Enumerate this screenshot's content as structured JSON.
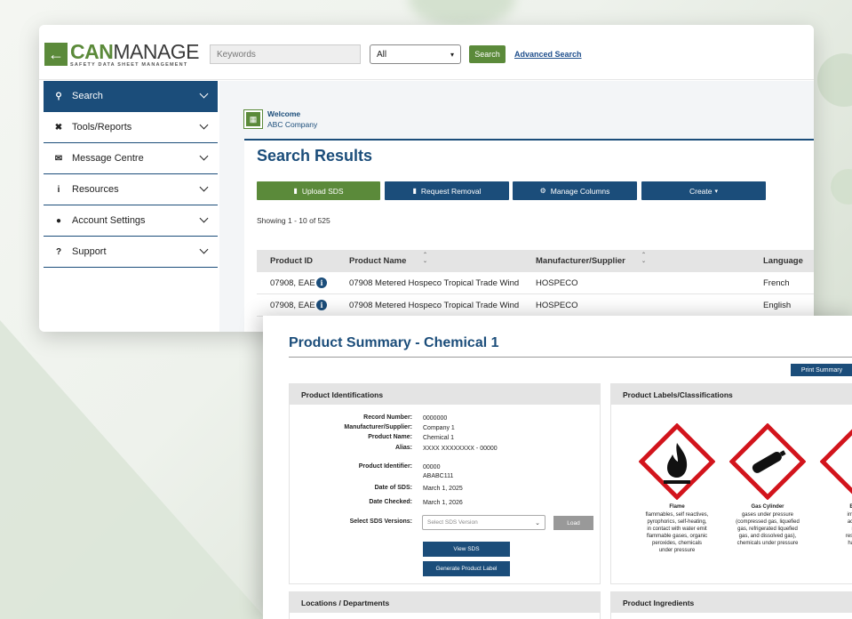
{
  "topbar": {
    "logo_can": "CAN",
    "logo_manage": "MANAGE",
    "logo_tagline": "SAFETY DATA SHEET MANAGEMENT",
    "keywords_placeholder": "Keywords",
    "scope_selected": "All",
    "search_label": "Search",
    "advanced_search_label": "Advanced Search"
  },
  "sidebar": {
    "items": [
      {
        "label": "Search",
        "icon": "search-icon",
        "active": true
      },
      {
        "label": "Tools/Reports",
        "icon": "tools-icon"
      },
      {
        "label": "Message Centre",
        "icon": "message-icon"
      },
      {
        "label": "Resources",
        "icon": "info-icon"
      },
      {
        "label": "Account Settings",
        "icon": "user-icon"
      },
      {
        "label": "Support",
        "icon": "question-icon"
      }
    ]
  },
  "welcome": {
    "greeting": "Welcome",
    "company": "ABC Company"
  },
  "results": {
    "title": "Search Results",
    "actions": {
      "upload": "Upload SDS",
      "request_removal": "Request Removal",
      "manage_columns": "Manage Columns",
      "create": "Create"
    },
    "showing_prefix": "Showing",
    "showing_range": "1 - 10",
    "showing_of": "of 525",
    "columns": [
      "Product ID",
      "Product Name",
      "Manufacturer/Supplier",
      "Language"
    ],
    "rows": [
      {
        "id": "07908, EAE",
        "name": "07908 Metered Hospeco Tropical Trade Wind",
        "manufacturer": "HOSPECO",
        "language": "French"
      },
      {
        "id": "07908, EAE",
        "name": "07908 Metered Hospeco Tropical Trade Wind",
        "manufacturer": "HOSPECO",
        "language": "English"
      }
    ]
  },
  "summary": {
    "title": "Product Summary - Chemical 1",
    "print_label": "Print Summary",
    "identifications": {
      "header": "Product Identifications",
      "record_number_label": "Record Number:",
      "record_number": "0000000",
      "manufacturer_label": "Manufacturer/Supplier:",
      "manufacturer": "Company 1",
      "product_name_label": "Product Name:",
      "product_name": "Chemical 1",
      "alias_label": "Alias:",
      "alias": "XXXX XXXXXXXX - 00000",
      "identifier_label": "Product Identifier:",
      "identifier_1": "00000",
      "identifier_2": "ABABC111",
      "date_sds_label": "Date of SDS:",
      "date_sds": "March 1, 2025",
      "date_checked_label": "Date Checked:",
      "date_checked": "March 1, 2026",
      "select_versions_label": "Select SDS Versions:",
      "select_versions_placeholder": "Select SDS Version",
      "load_label": "Load",
      "view_sds_label": "View SDS",
      "generate_label_label": "Generate Product Label"
    },
    "labels": {
      "header": "Product Labels/Classifications",
      "pictograms": [
        {
          "name": "Flame",
          "icon": "flame-icon",
          "desc": [
            "flammables, self reactives,",
            "pyrophorics, self-heating,",
            "in contact with water emit",
            "flammable gases, organic",
            "peroxides, chemicals",
            "under pressure"
          ]
        },
        {
          "name": "Gas Cylinder",
          "icon": "gas-cylinder-icon",
          "desc": [
            "gases under pressure",
            "(compressed gas, liquefied",
            "gas, refrigerated liquefied",
            "gas, and dissolved gas),",
            "chemicals under pressure"
          ]
        },
        {
          "name": "Exclan",
          "icon": "exclamation-icon",
          "desc": [
            "irritation (",
            "acute tox",
            "narco",
            "respiratory",
            "harmful t"
          ]
        }
      ]
    },
    "locations_header": "Locations / Departments",
    "ingredients_header": "Product Ingredients"
  },
  "colors": {
    "brand_green": "#5b8a3a",
    "brand_blue": "#1b4d7a",
    "hazard_red": "#d2141c"
  }
}
